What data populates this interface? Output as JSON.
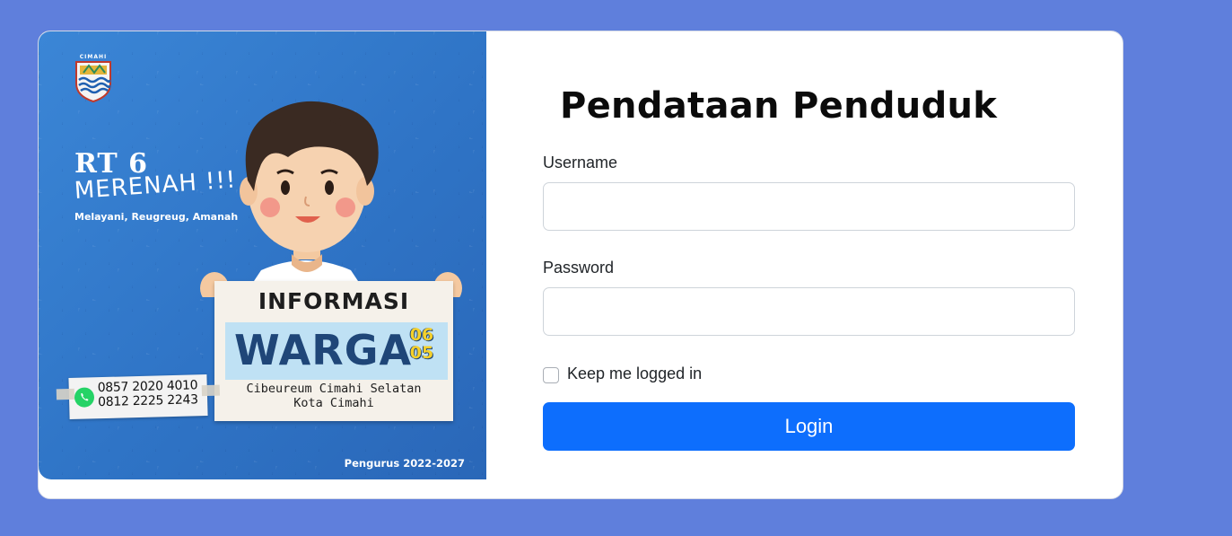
{
  "banner": {
    "crest_text": "CIMAHI",
    "rt_title": "RT 6",
    "rt_sub": "MERENAH !!!",
    "tagline": "Melayani, Reugreug, Amanah",
    "sign_title": "INFORMASI",
    "sign_big": "WARGA",
    "sign_num_top": "06",
    "sign_num_bottom": "05",
    "sign_loc_line1": "Cibeureum Cimahi Selatan",
    "sign_loc_line2": "Kota Cimahi",
    "phone_1": "0857 2020 4010",
    "phone_2": "0812 2225 2243",
    "footer": "Pengurus 2022-2027",
    "bg_color": "#3b86d6"
  },
  "form": {
    "title": "Pendataan Penduduk",
    "username_label": "Username",
    "username_value": "",
    "password_label": "Password",
    "password_value": "",
    "remember_label": "Keep me logged in",
    "remember_checked": false,
    "login_label": "Login",
    "button_color": "#0d6efd"
  },
  "page": {
    "background_color": "#5f7fdc"
  }
}
